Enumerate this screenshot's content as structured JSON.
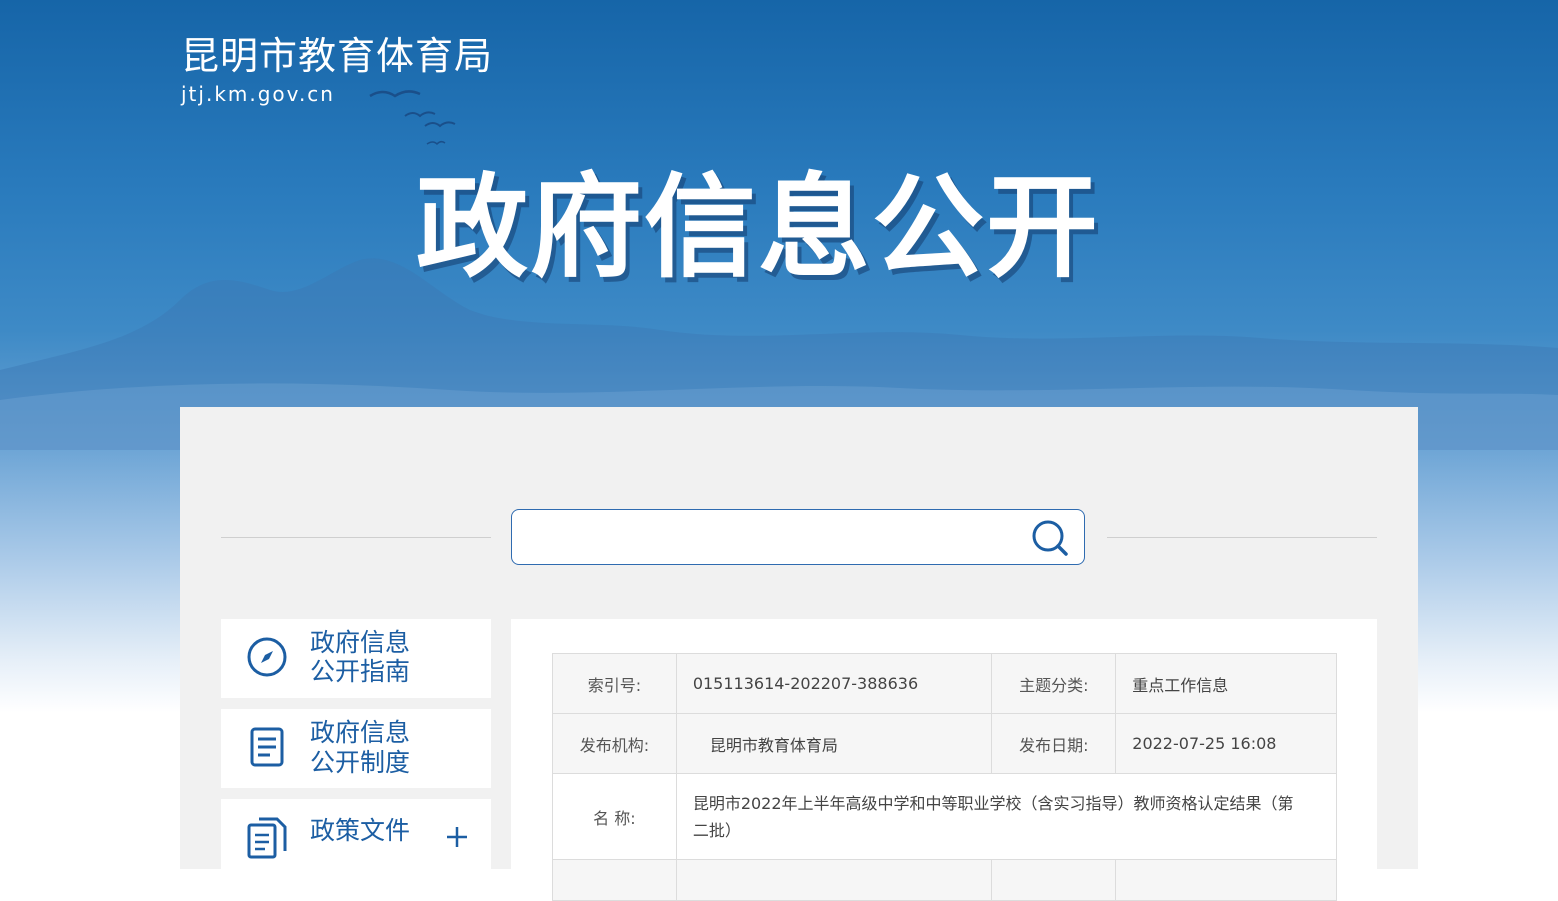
{
  "header": {
    "site_title": "昆明市教育体育局",
    "site_domain": "jtj.km.gov.cn",
    "banner_title": "政府信息公开"
  },
  "search": {
    "placeholder": "",
    "value": "",
    "icon": "search-icon"
  },
  "sidebar": {
    "items": [
      {
        "line1": "政府信息",
        "line2": "公开指南",
        "icon": "compass-icon"
      },
      {
        "line1": "政府信息",
        "line2": "公开制度",
        "icon": "document-icon"
      },
      {
        "line1": "政策文件",
        "line2": "",
        "icon": "documents-icon",
        "expand": "plus-icon"
      }
    ]
  },
  "meta_table": {
    "index_label": "索引号:",
    "index_value": "015113614-202207-388636",
    "topic_label": "主题分类:",
    "topic_value": "重点工作信息",
    "org_label": "发布机构:",
    "org_value": "昆明市教育体育局",
    "date_label": "发布日期:",
    "date_value": "2022-07-25 16:08",
    "name_label": "名 称:",
    "name_value": "昆明市2022年上半年高级中学和中等职业学校（含实习指导）教师资格认定结果（第二批）"
  },
  "colors": {
    "brand_blue": "#1c5ea3",
    "header_top": "#1665a8",
    "panel_bg": "#f1f1f1"
  }
}
